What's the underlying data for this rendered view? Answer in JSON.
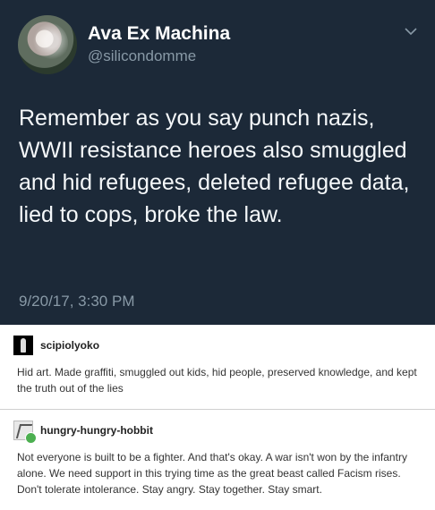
{
  "tweet": {
    "display_name": "Ava Ex Machina",
    "handle": "@silicondomme",
    "text": "Remember as you say punch nazis, WWII resistance heroes also smuggled and hid refugees, deleted refugee data, lied to cops, broke the law.",
    "timestamp": "9/20/17, 3:30 PM",
    "colors": {
      "background": "#1c2938",
      "secondary_text": "#8899a6"
    }
  },
  "posts": [
    {
      "username": "scipiolyoko",
      "body": "Hid art. Made graffiti, smuggled out kids, hid people, preserved knowledge, and kept the truth out of the lies"
    },
    {
      "username": "hungry-hungry-hobbit",
      "body": "Not everyone is built to be a fighter. And that's okay. A war isn't won by the infantry alone. We need support in this trying time as the great beast called Facism rises. Don't tolerate intolerance. Stay angry. Stay together. Stay smart."
    }
  ]
}
